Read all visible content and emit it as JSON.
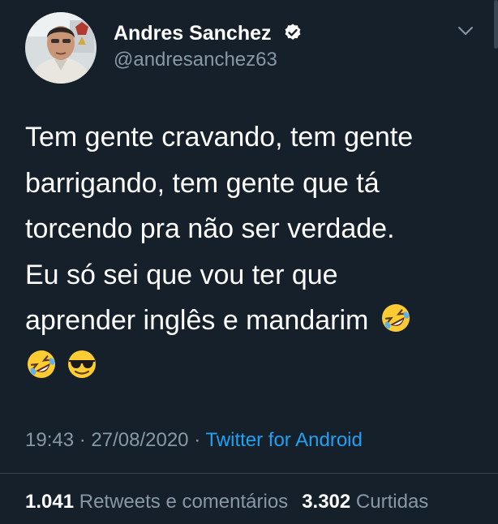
{
  "user": {
    "display_name": "Andres Sanchez",
    "handle": "@andresanchez63",
    "verified": true
  },
  "tweet": {
    "lines": [
      "Tem gente cravando, tem gente",
      "barrigando, tem gente que tá",
      "torcendo pra não ser verdade.",
      "Eu só sei que vou ter que",
      "aprender inglês e mandarim"
    ],
    "inline_emoji": "rolling-on-floor-laughing-emoji",
    "trailing_emojis": [
      "rolling-on-floor-laughing-emoji",
      "smiling-face-with-sunglasses-emoji"
    ]
  },
  "meta": {
    "time": "19:43",
    "sep1": "·",
    "date": "27/08/2020",
    "sep2": "·",
    "source": "Twitter for Android"
  },
  "stats": {
    "retweets_count": "1.041",
    "retweets_label": "Retweets e comentários",
    "likes_count": "3.302",
    "likes_label": "Curtidas"
  },
  "colors": {
    "background": "#15202b",
    "text": "#ffffff",
    "secondary": "#8899a6",
    "link": "#1da1f2",
    "divider": "#38444d"
  }
}
